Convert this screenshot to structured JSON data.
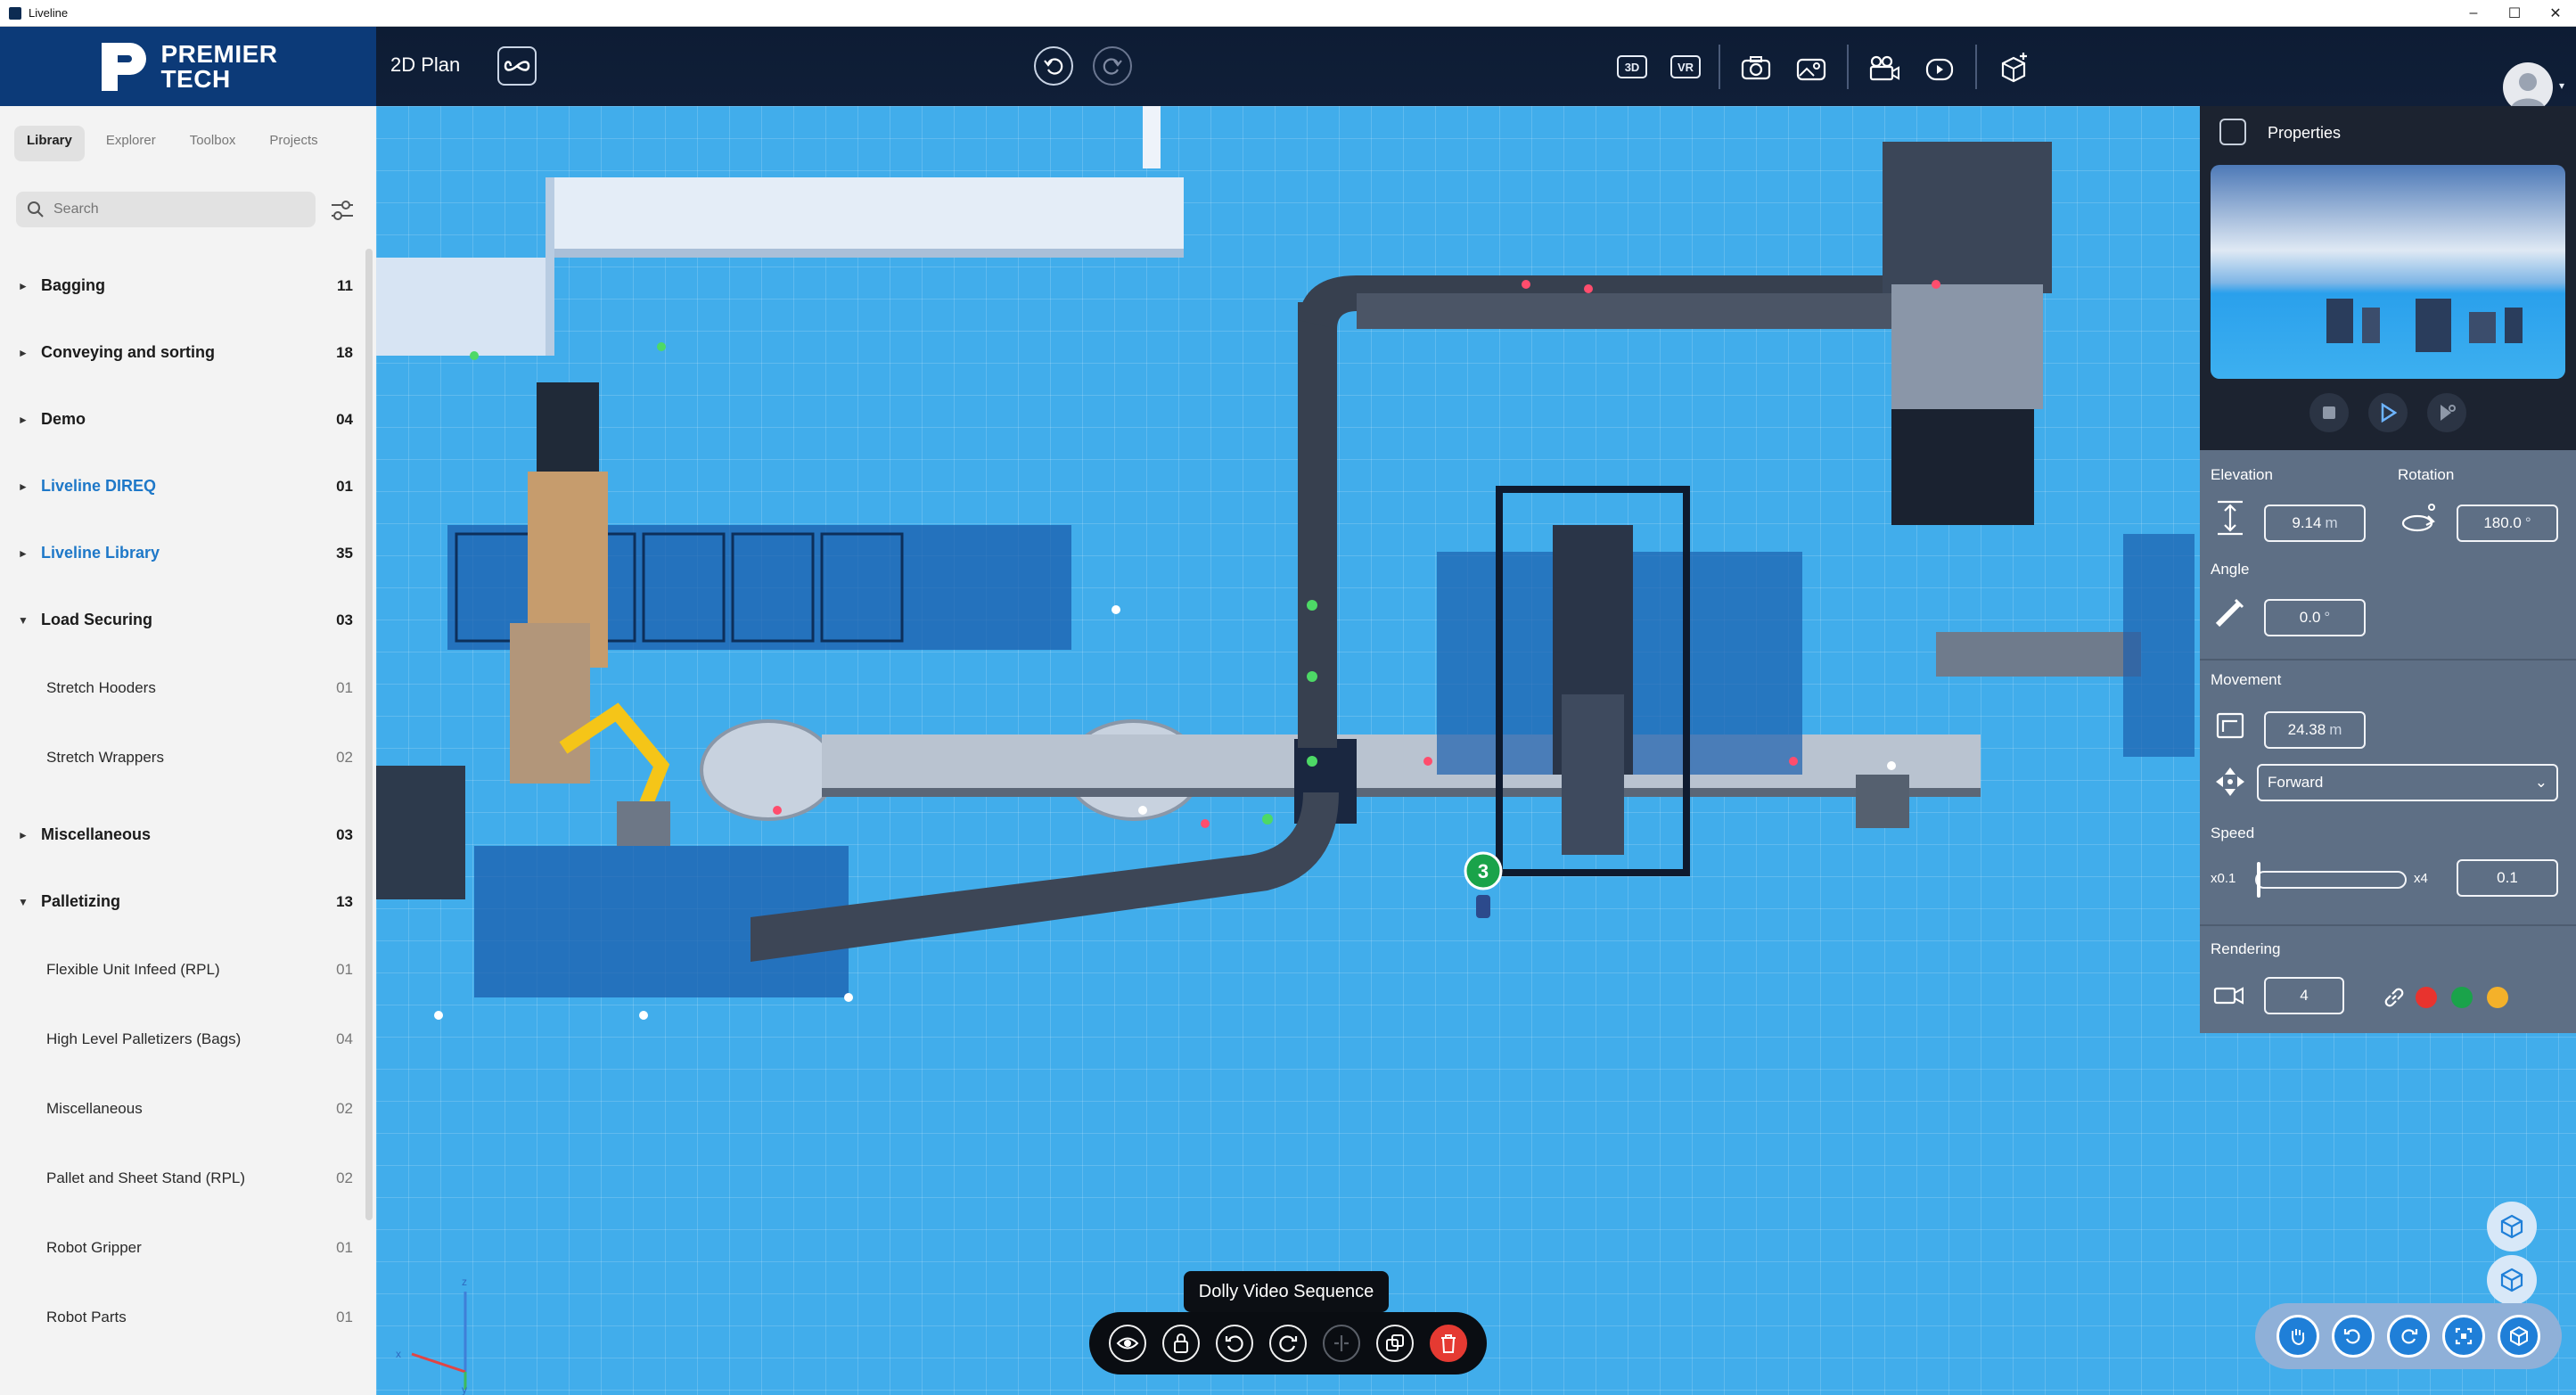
{
  "window": {
    "title": "Liveline",
    "controls": [
      "–",
      "☐",
      "✕"
    ]
  },
  "header": {
    "logo_line1": "PREMIER",
    "logo_line2": "TECH",
    "view_title": "2D Plan",
    "toggle_3d": "3D",
    "toggle_vr": "VR"
  },
  "library": {
    "tabs": [
      "Library",
      "Explorer",
      "Toolbox",
      "Projects"
    ],
    "active_tab": "Library",
    "search_placeholder": "Search",
    "categories": [
      {
        "label": "Bagging",
        "count": "11",
        "expanded": false
      },
      {
        "label": "Conveying and sorting",
        "count": "18",
        "expanded": false
      },
      {
        "label": "Demo",
        "count": "04",
        "expanded": false
      },
      {
        "label": "Liveline DIREQ",
        "count": "01",
        "expanded": false,
        "link": true
      },
      {
        "label": "Liveline Library",
        "count": "35",
        "expanded": false,
        "link": true
      },
      {
        "label": "Load Securing",
        "count": "03",
        "expanded": true
      },
      {
        "label": "Miscellaneous",
        "count": "03",
        "expanded": false
      },
      {
        "label": "Palletizing",
        "count": "13",
        "expanded": true
      }
    ],
    "load_securing_items": [
      {
        "label": "Stretch Hooders",
        "count": "01"
      },
      {
        "label": "Stretch Wrappers",
        "count": "02"
      }
    ],
    "palletizing_items": [
      {
        "label": "Flexible Unit Infeed (RPL)",
        "count": "01"
      },
      {
        "label": "High Level Palletizers (Bags)",
        "count": "04"
      },
      {
        "label": "Miscellaneous",
        "count": "02"
      },
      {
        "label": "Pallet and Sheet Stand (RPL)",
        "count": "02"
      },
      {
        "label": "Robot Gripper",
        "count": "01"
      },
      {
        "label": "Robot Parts",
        "count": "01"
      }
    ]
  },
  "properties": {
    "title": "Properties",
    "elevation_label": "Elevation",
    "elevation_value": "9.14",
    "elevation_unit": "m",
    "rotation_label": "Rotation",
    "rotation_value": "180.0",
    "rotation_unit": "°",
    "angle_label": "Angle",
    "angle_value": "0.0",
    "angle_unit": "°",
    "movement_label": "Movement",
    "movement_value": "24.38",
    "movement_unit": "m",
    "direction_value": "Forward",
    "speed_label": "Speed",
    "speed_min": "x0.1",
    "speed_max": "x4",
    "speed_value": "0.1",
    "speed_level": 0.0,
    "rendering_label": "Rendering",
    "rendering_value": "4",
    "color_swatches": [
      "#e8332e",
      "#1aa34a",
      "#f4b12a"
    ]
  },
  "viewport": {
    "camera_marker": "3",
    "axis_z": "z",
    "axis_x": "x",
    "axis_y": "y"
  },
  "toolbar": {
    "tooltip": "Dolly Video Sequence",
    "buttons": [
      "eye-icon",
      "lock-icon",
      "rotate-left-icon",
      "rotate-right-icon",
      "split-icon",
      "duplicate-icon",
      "trash-icon"
    ]
  },
  "colors": {
    "header_bg": "#0d1c34",
    "logo_bg": "#0c3a78",
    "floor": "#41adeb",
    "panel": "#5e6f85",
    "accent": "#1e78c8"
  }
}
